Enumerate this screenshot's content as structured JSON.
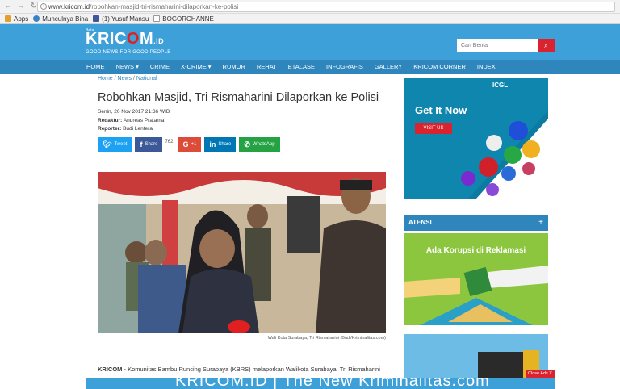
{
  "browser": {
    "url_domain": "www.kricom.id",
    "url_path": "/robohkan-masjid-tri-rismaharini-dilaporkan-ke-polisi",
    "bookmarks": [
      "Apps",
      "Munculnya Bina",
      "(1) Yusuf Mansu",
      "BOGORCHANNE"
    ]
  },
  "header": {
    "beta": "Beta",
    "brand_pre": "KRIC",
    "brand_o": "O",
    "brand_m": "M",
    "brand_suffix": ".ID",
    "tagline": "GOOD NEWS FOR GOOD PEOPLE",
    "search_placeholder": "Cari Berita"
  },
  "nav": [
    "HOME",
    "NEWS ▾",
    "CRIME",
    "X-CRIME ▾",
    "RUMOR",
    "REHAT",
    "ETALASE",
    "INFOGRAFIS",
    "GALLERY",
    "KRICOM CORNER",
    "INDEX"
  ],
  "article": {
    "breadcrumb": [
      "Home",
      "News",
      "National"
    ],
    "title": "Robohkan Masjid, Tri Rismaharini Dilaporkan ke Polisi",
    "date": "Senin, 20 Nov 2017 21:36 WIB",
    "redaktur_label": "Redaktur:",
    "redaktur": "Andreas Pratama",
    "reporter_label": "Reporter:",
    "reporter": "Budi Lentera",
    "caption": "Wali Kota Surabaya, Tri Rismaharini (Budi/Kriminalitas.com)",
    "lead_source": "KRICOM",
    "lead_text": " - Komunitas Bambu Runcing Surabaya (KBRS) melaporkan Walikota Surabaya, Tri Rismaharini"
  },
  "share": {
    "tweet": "Tweet",
    "facebook": "Share",
    "facebook_count": "762",
    "gplus": "+1",
    "linkedin": "Share",
    "whatsapp": "WhatsApp"
  },
  "sidebar": {
    "ad_brand": "ICGL",
    "ad_title": "Get It Now",
    "ad_button": "VISIT US",
    "atensi_title": "ATENSI",
    "atensi_plus": "+",
    "atensi_card_title": "Ada Korupsi di Reklamasi"
  },
  "bottom": {
    "banner_text": "KRICOM.ID | The New Kriminalitas.com",
    "close_ads": "Close Ads X"
  },
  "colors": {
    "header_blue": "#3ea0d8",
    "nav_blue": "#2f86bd",
    "accent_red": "#d9232e"
  }
}
